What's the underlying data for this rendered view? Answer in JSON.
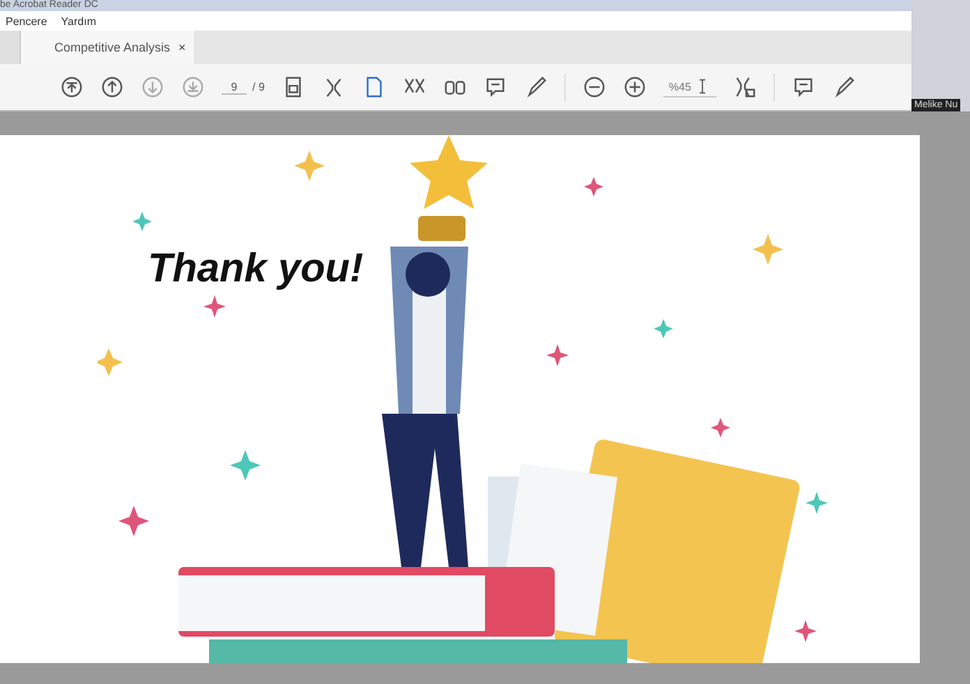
{
  "window": {
    "title": "be Acrobat Reader DC"
  },
  "menu": {
    "items": [
      "Pencere",
      "Yardım"
    ]
  },
  "tabs": [
    {
      "label": "Competitive Analysis",
      "selected": true,
      "close": "×"
    }
  ],
  "toolbar": {
    "page_current": "9",
    "page_total": "/ 9",
    "zoom": "%45"
  },
  "video_tile": {
    "name": "Melike Nu"
  },
  "slide": {
    "heading": "Thank you!"
  }
}
